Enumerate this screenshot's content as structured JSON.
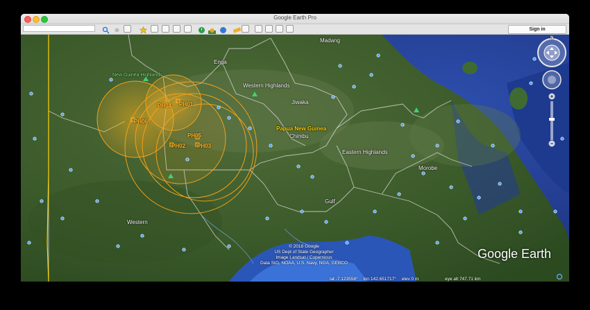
{
  "window": {
    "title": "Google Earth Pro"
  },
  "toolbar": {
    "search_value": "",
    "signin_label": "Sign in"
  },
  "map": {
    "regions": [
      {
        "name": "madang",
        "label": "Madang"
      },
      {
        "name": "enga",
        "label": "Enga"
      },
      {
        "name": "western-highlands",
        "label": "Western Highlands"
      },
      {
        "name": "jiwaka",
        "label": "Jiwaka"
      },
      {
        "name": "chimbu",
        "label": "Chimbu"
      },
      {
        "name": "eastern-highlands",
        "label": "Eastern Highlands"
      },
      {
        "name": "morobe",
        "label": "Morobe"
      },
      {
        "name": "gulf",
        "label": "Gulf"
      },
      {
        "name": "western",
        "label": "Western"
      }
    ],
    "park_label": "New Guinea Highlands",
    "country_label": "Papua New Guinea",
    "markers": [
      "PH01",
      "PH04",
      "PH05",
      "PH02",
      "PH03",
      "PH06"
    ]
  },
  "copyright": {
    "line1": "© 2018 Google",
    "line2": "US Dept of State Geographer",
    "line3": "Image Landsat / Copernicus",
    "line4": "Data SIO, NOAA, U.S. Navy, NGA, GEBCO"
  },
  "logo": "Google Earth",
  "status": {
    "lat": "lat  -7.123558°",
    "lon": "lon  142.651717°",
    "elev": "elev    0 m",
    "eye": "eye alt  747.71 km"
  },
  "nav": {
    "compass_north": "N"
  }
}
